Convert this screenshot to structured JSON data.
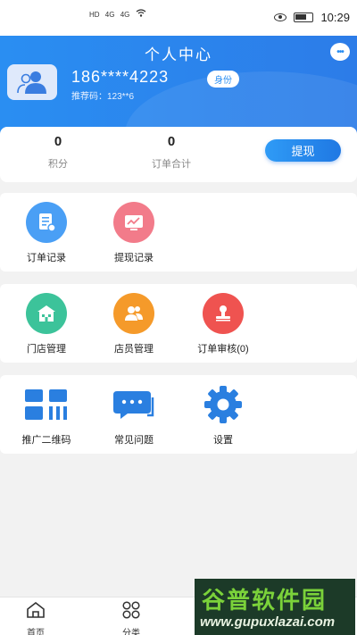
{
  "status_bar": {
    "left_icons": [
      "HD",
      "4G",
      "4G",
      "HD"
    ],
    "time": "10:29"
  },
  "header": {
    "title": "个人中心",
    "phone": "186****4223",
    "badge": "身份",
    "referral": "推荐码：123**6"
  },
  "stats": {
    "points": {
      "value": "0",
      "label": "积分"
    },
    "order_total": {
      "value": "0",
      "label": "订单合计"
    },
    "withdraw_button": "提现"
  },
  "menu": {
    "row1": [
      {
        "label": "订单记录",
        "icon": "order-record-icon",
        "color": "#4a9ff5"
      },
      {
        "label": "提现记录",
        "icon": "withdraw-record-icon",
        "color": "#f27b8a"
      }
    ],
    "row2": [
      {
        "label": "门店管理",
        "icon": "store-icon",
        "color": "#3cc39a"
      },
      {
        "label": "店员管理",
        "icon": "staff-icon",
        "color": "#f59a2a"
      },
      {
        "label": "订单审核(0)",
        "icon": "stamp-icon",
        "color": "#ef5350"
      }
    ],
    "row3": [
      {
        "label": "推广二维码",
        "icon": "qr-code-icon",
        "color": "#2a7fe0"
      },
      {
        "label": "常见问题",
        "icon": "faq-chat-icon",
        "color": "#2a7fe0"
      },
      {
        "label": "设置",
        "icon": "gear-icon",
        "color": "#2a7fe0"
      }
    ]
  },
  "tabbar": {
    "home": "首页",
    "category": "分类"
  },
  "watermark": {
    "title": "谷普软件园",
    "url": "www.gupuxlazai.com"
  }
}
